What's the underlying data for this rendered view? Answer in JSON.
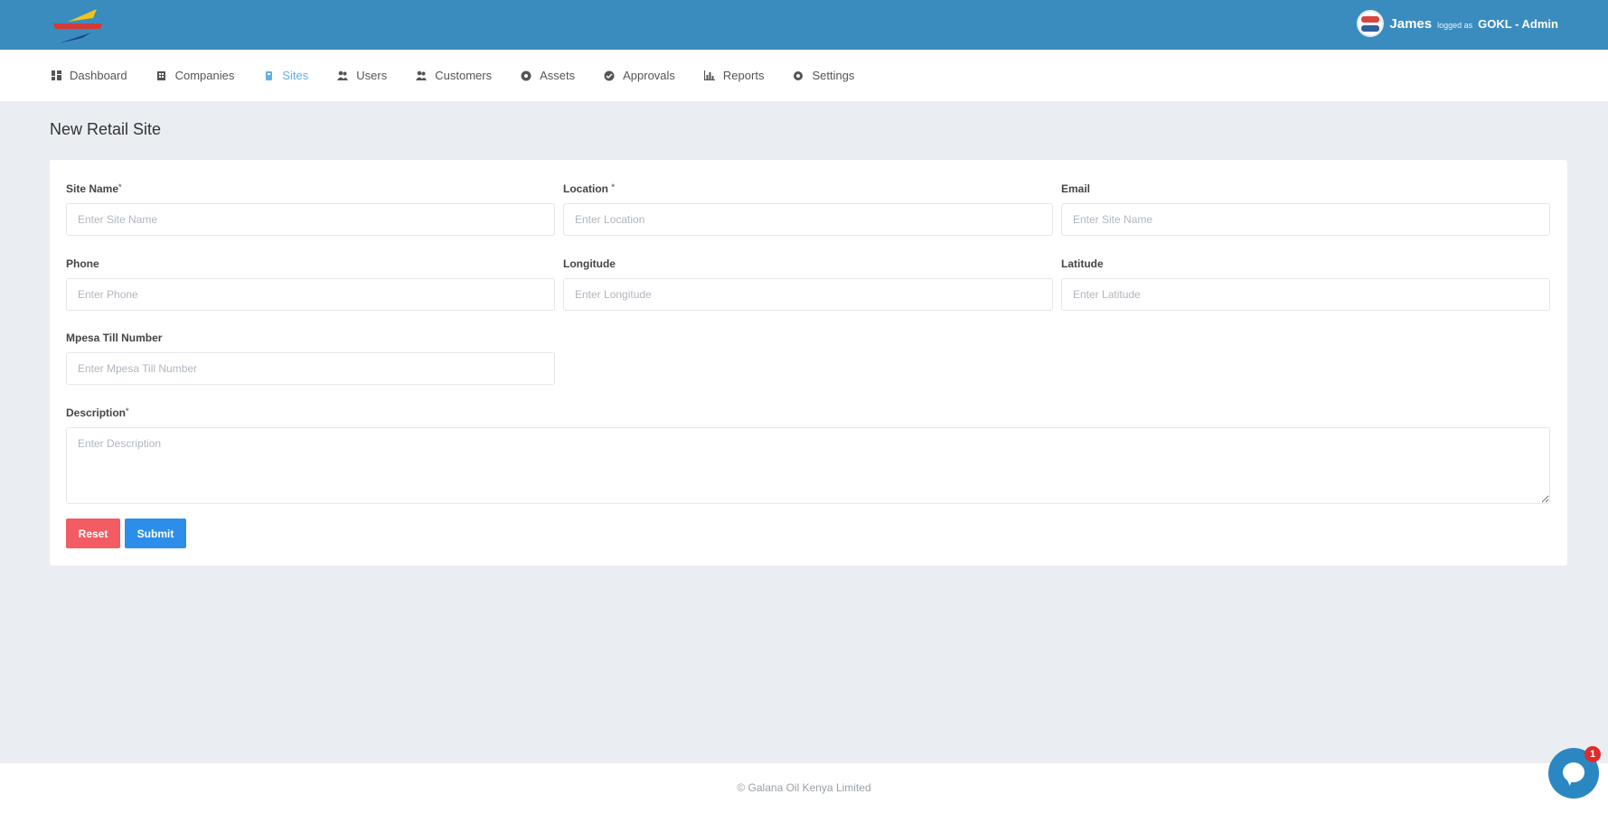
{
  "header": {
    "user_name": "James",
    "logged_as": "logged as",
    "org_role": "GOKL - Admin"
  },
  "nav": {
    "items": [
      {
        "label": "Dashboard",
        "icon": "dashboard-icon"
      },
      {
        "label": "Companies",
        "icon": "building-icon"
      },
      {
        "label": "Sites",
        "icon": "site-icon",
        "active": true
      },
      {
        "label": "Users",
        "icon": "users-icon"
      },
      {
        "label": "Customers",
        "icon": "customers-icon"
      },
      {
        "label": "Assets",
        "icon": "asset-icon"
      },
      {
        "label": "Approvals",
        "icon": "check-circle-icon"
      },
      {
        "label": "Reports",
        "icon": "bar-chart-icon"
      },
      {
        "label": "Settings",
        "icon": "gear-icon"
      }
    ],
    "active_color": "#64aee8"
  },
  "page": {
    "title": "New Retail Site"
  },
  "form": {
    "site_name": {
      "label": "Site Name",
      "required_mark": "*",
      "placeholder": "Enter Site Name",
      "value": ""
    },
    "location": {
      "label": "Location",
      "required_mark": "*",
      "placeholder": "Enter Location",
      "value": ""
    },
    "email": {
      "label": "Email",
      "placeholder": "Enter Site Name",
      "value": ""
    },
    "phone": {
      "label": "Phone",
      "placeholder": "Enter Phone",
      "value": ""
    },
    "longitude": {
      "label": "Longitude",
      "placeholder": "Enter Longitude",
      "value": ""
    },
    "latitude": {
      "label": "Latitude",
      "placeholder": "Enter Latitude",
      "value": ""
    },
    "mpesa": {
      "label": "Mpesa Till Number",
      "placeholder": "Enter Mpesa Till Number",
      "value": ""
    },
    "description": {
      "label": "Description",
      "required_mark": "*",
      "placeholder": "Enter Description",
      "value": ""
    },
    "reset_label": "Reset",
    "submit_label": "Submit"
  },
  "footer": {
    "text": "© Galana Oil Kenya Limited"
  },
  "chat": {
    "badge": "1"
  },
  "colors": {
    "topbar": "#3a8cbf",
    "reset": "#f25c62",
    "submit": "#2c8ee8",
    "background": "#eaeef2"
  }
}
